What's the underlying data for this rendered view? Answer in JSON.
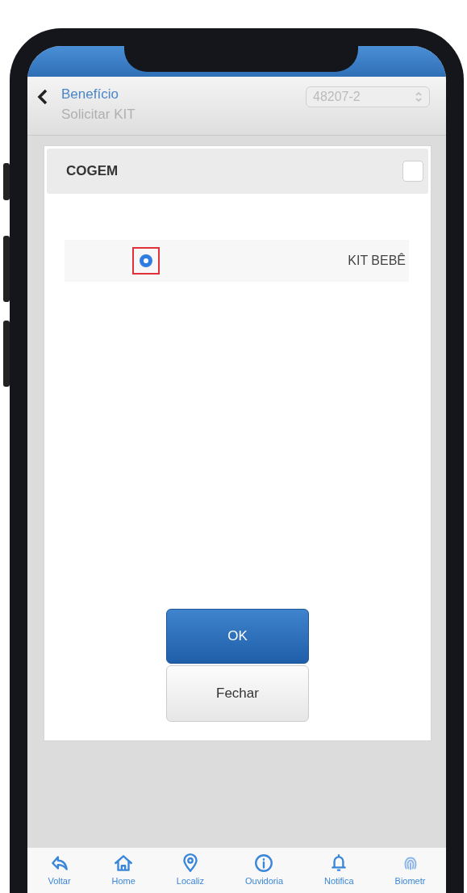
{
  "header": {
    "title": "Benefício",
    "subtitle": "Solicitar KIT",
    "selector": {
      "value": "48207-2"
    }
  },
  "group": {
    "title": "COGEM",
    "checked": false
  },
  "options": [
    {
      "label": "KIT BEBÊ",
      "selected": true,
      "highlighted": true
    }
  ],
  "buttons": [
    {
      "label": "OK",
      "kind": "primary"
    },
    {
      "label": "Fechar",
      "kind": "secondary"
    }
  ],
  "tab_bar": [
    {
      "label": "Voltar",
      "kind": "back"
    },
    {
      "label": "Home",
      "kind": "home"
    },
    {
      "label": "Localiz",
      "kind": "location"
    },
    {
      "label": "Ouvidoria",
      "kind": "info"
    },
    {
      "label": "Notifica",
      "kind": "bell"
    },
    {
      "label": "Biometr",
      "kind": "fingerprint"
    }
  ]
}
